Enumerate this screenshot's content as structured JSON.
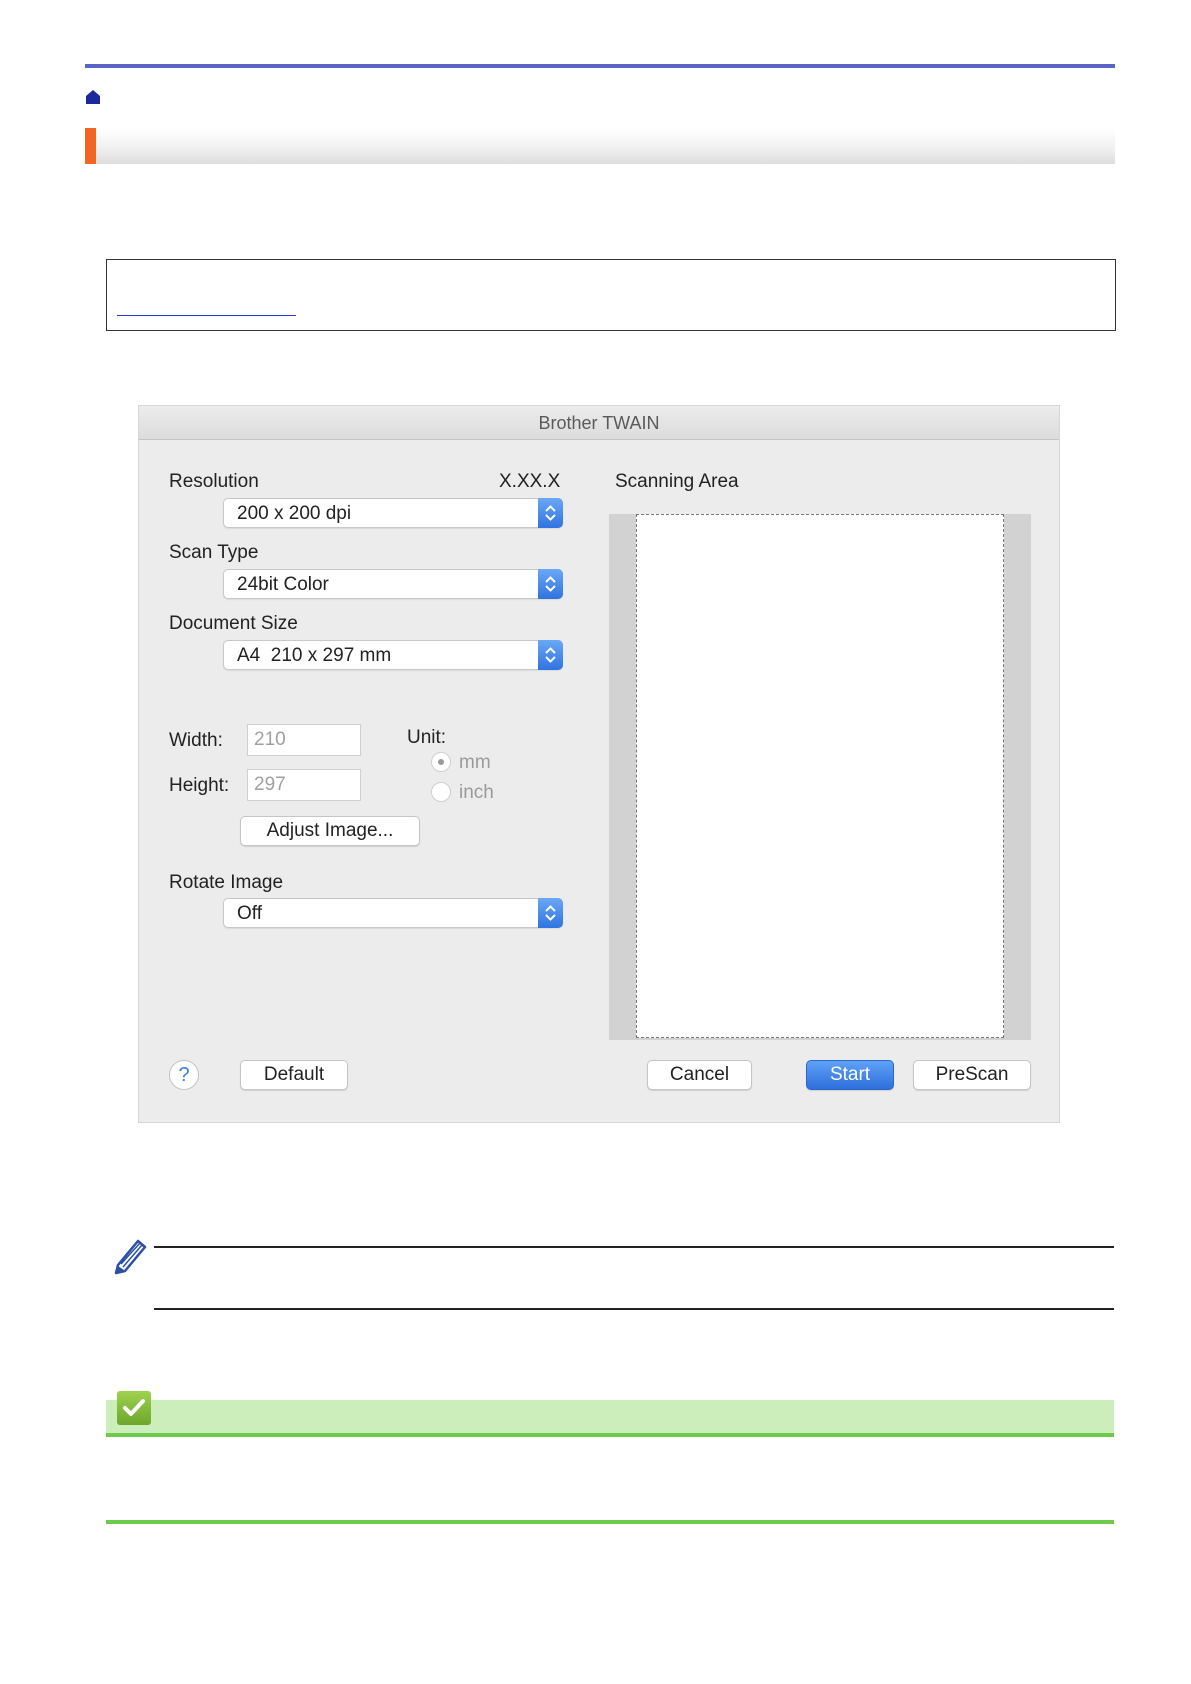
{
  "page": {
    "icons": {
      "home": "home-icon",
      "note": "pencil-icon",
      "related": "checkmark-icon"
    },
    "colors": {
      "top_rule": "#5b63c7",
      "title_accent": "#f26522",
      "link": "#2a3fc1",
      "related_bar": "#cbeebb",
      "related_rule": "#6ccb4c"
    }
  },
  "dialog": {
    "title": "Brother TWAIN",
    "version": "X.XX.X",
    "resolution": {
      "label": "Resolution",
      "value": "200 x 200 dpi"
    },
    "scan_type": {
      "label": "Scan Type",
      "value": "24bit Color"
    },
    "document_size": {
      "label": "Document Size",
      "value": "A4  210 x 297 mm"
    },
    "width": {
      "label": "Width:",
      "value": "210"
    },
    "height": {
      "label": "Height:",
      "value": "297"
    },
    "unit": {
      "label": "Unit:",
      "options": [
        {
          "label": "mm",
          "selected": true
        },
        {
          "label": "inch",
          "selected": false
        }
      ]
    },
    "adjust_image_button": "Adjust Image...",
    "rotate_image": {
      "label": "Rotate Image",
      "value": "Off"
    },
    "scanning_area_label": "Scanning Area",
    "help_button": "?",
    "default_button": "Default",
    "cancel_button": "Cancel",
    "start_button": "Start",
    "prescan_button": "PreScan",
    "accent_color": "#2f73e0"
  }
}
